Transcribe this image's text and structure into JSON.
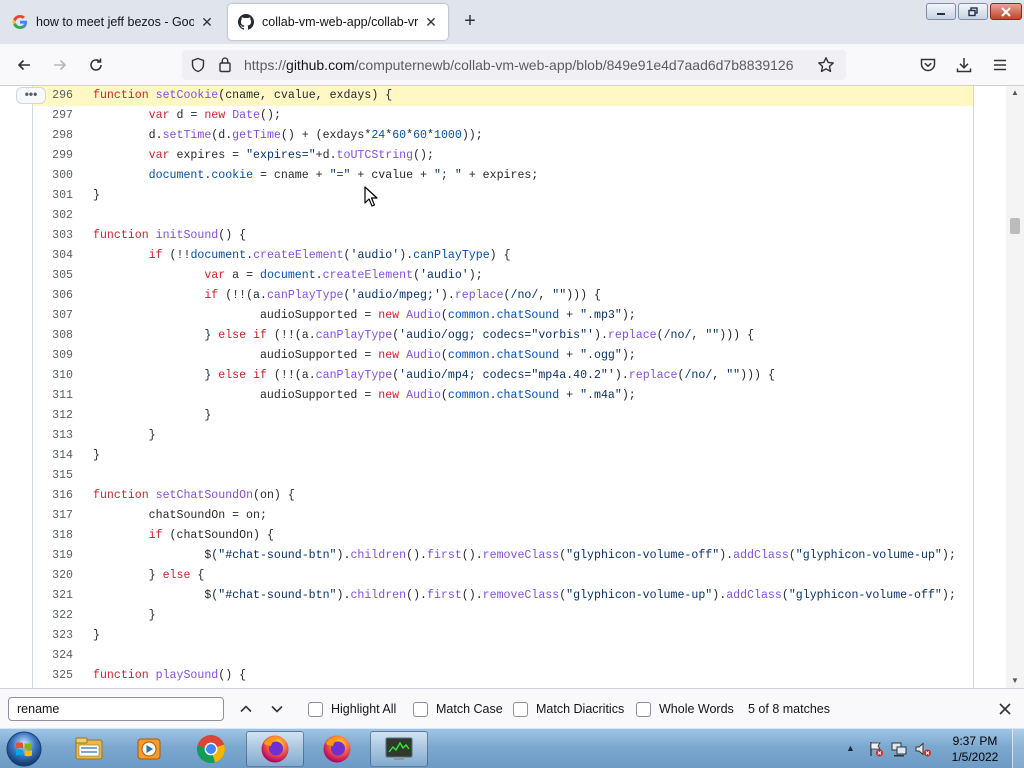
{
  "browser": {
    "tabs": [
      {
        "label": "how to meet jeff bezos - Google",
        "icon": "google-icon",
        "active": false
      },
      {
        "label": "collab-vm-web-app/collab-vm",
        "icon": "github-icon",
        "active": true
      }
    ],
    "url_scheme": "https://",
    "url_host": "github.com",
    "url_path": "/computernewb/collab-vm-web-app/blob/849e91e4d7aad6d7b8839126"
  },
  "code": {
    "lines": [
      {
        "n": "296",
        "t": "function setCookie(cname, cvalue, exdays) {",
        "hl": true
      },
      {
        "n": "297",
        "t": "        var d = new Date();"
      },
      {
        "n": "298",
        "t": "        d.setTime(d.getTime() + (exdays*24*60*60*1000));"
      },
      {
        "n": "299",
        "t": "        var expires = \"expires=\"+d.toUTCString();"
      },
      {
        "n": "300",
        "t": "        document.cookie = cname + \"=\" + cvalue + \"; \" + expires;"
      },
      {
        "n": "301",
        "t": "}"
      },
      {
        "n": "302",
        "t": ""
      },
      {
        "n": "303",
        "t": "function initSound() {"
      },
      {
        "n": "304",
        "t": "        if (!!document.createElement('audio').canPlayType) {"
      },
      {
        "n": "305",
        "t": "                var a = document.createElement('audio');"
      },
      {
        "n": "306",
        "t": "                if (!!(a.canPlayType('audio/mpeg;').replace(/no/, \"\"))) {"
      },
      {
        "n": "307",
        "t": "                        audioSupported = new Audio(common.chatSound + \".mp3\");"
      },
      {
        "n": "308",
        "t": "                } else if (!!(a.canPlayType('audio/ogg; codecs=\"vorbis\"').replace(/no/, \"\"))) {"
      },
      {
        "n": "309",
        "t": "                        audioSupported = new Audio(common.chatSound + \".ogg\");"
      },
      {
        "n": "310",
        "t": "                } else if (!!(a.canPlayType('audio/mp4; codecs=\"mp4a.40.2\"').replace(/no/, \"\"))) {"
      },
      {
        "n": "311",
        "t": "                        audioSupported = new Audio(common.chatSound + \".m4a\");"
      },
      {
        "n": "312",
        "t": "                }"
      },
      {
        "n": "313",
        "t": "        }"
      },
      {
        "n": "314",
        "t": "}"
      },
      {
        "n": "315",
        "t": ""
      },
      {
        "n": "316",
        "t": "function setChatSoundOn(on) {"
      },
      {
        "n": "317",
        "t": "        chatSoundOn = on;"
      },
      {
        "n": "318",
        "t": "        if (chatSoundOn) {"
      },
      {
        "n": "319",
        "t": "                $(\"#chat-sound-btn\").children().first().removeClass(\"glyphicon-volume-off\").addClass(\"glyphicon-volume-up\");"
      },
      {
        "n": "320",
        "t": "        } else {"
      },
      {
        "n": "321",
        "t": "                $(\"#chat-sound-btn\").children().first().removeClass(\"glyphicon-volume-up\").addClass(\"glyphicon-volume-off\");"
      },
      {
        "n": "322",
        "t": "        }"
      },
      {
        "n": "323",
        "t": "}"
      },
      {
        "n": "324",
        "t": ""
      },
      {
        "n": "325",
        "t": "function playSound() {"
      }
    ]
  },
  "findbar": {
    "query": "rename",
    "options": [
      {
        "label": "Highlight All",
        "checked": false
      },
      {
        "label": "Match Case",
        "checked": false
      },
      {
        "label": "Match Diacritics",
        "checked": false
      },
      {
        "label": "Whole Words",
        "checked": false
      }
    ],
    "status": "5 of 8 matches"
  },
  "taskbar": {
    "items": [
      "explorer-icon",
      "media-player-icon",
      "chrome-icon",
      "firefox-icon",
      "firefox-icon",
      "task-manager-icon"
    ],
    "time": "9:37 PM",
    "date": "1/5/2022"
  },
  "colors": {
    "keyword": "#cf222e",
    "function": "#8250df",
    "string": "#0a3069",
    "constant": "#0550ae",
    "line_highlight": "#fff8c5"
  }
}
